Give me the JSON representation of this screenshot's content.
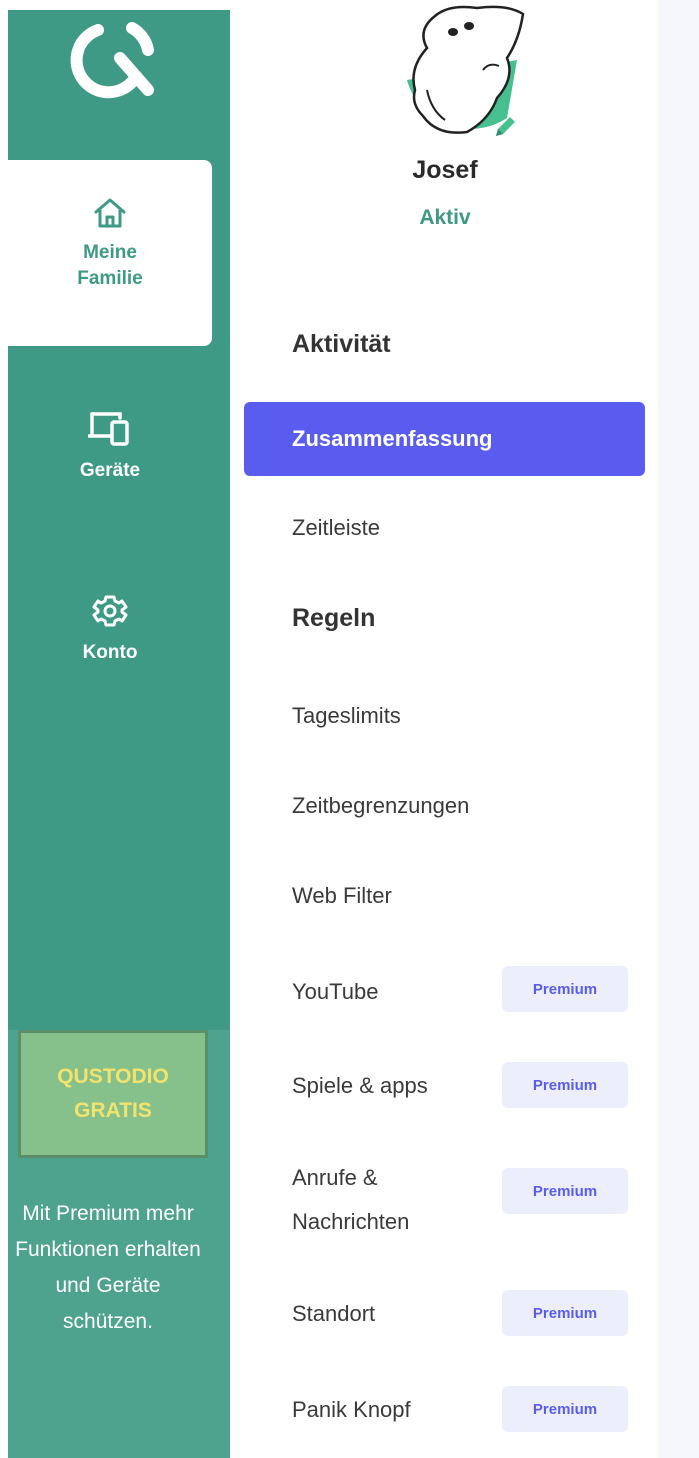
{
  "nav": {
    "items": [
      {
        "label": "Meine Familie",
        "icon": "home-icon"
      },
      {
        "label": "Geräte",
        "icon": "devices-icon"
      },
      {
        "label": "Konto",
        "icon": "gear-icon"
      }
    ]
  },
  "promo": {
    "line1": "QUSTODIO",
    "line2": "GRATIS",
    "text": "Mit Premium mehr Funktionen erhalten und Geräte schützen."
  },
  "profile": {
    "name": "Josef",
    "status": "Aktiv"
  },
  "menu": {
    "section_activity": "Aktivität",
    "summary": "Zusammenfassung",
    "timeline": "Zeitleiste",
    "section_rules": "Regeln",
    "daily_limits": "Tageslimits",
    "time_restrictions": "Zeitbegrenzungen",
    "web_filter": "Web Filter",
    "youtube": "YouTube",
    "games_apps": "Spiele & apps",
    "calls_messages": "Anrufe & Nachrichten",
    "location": "Standort",
    "panic_button": "Panik Knopf",
    "premium_badge": "Premium"
  },
  "colors": {
    "brand_green": "#3e9a85",
    "accent_purple": "#5a5cf0",
    "promo_yellow": "#f3e36d"
  }
}
